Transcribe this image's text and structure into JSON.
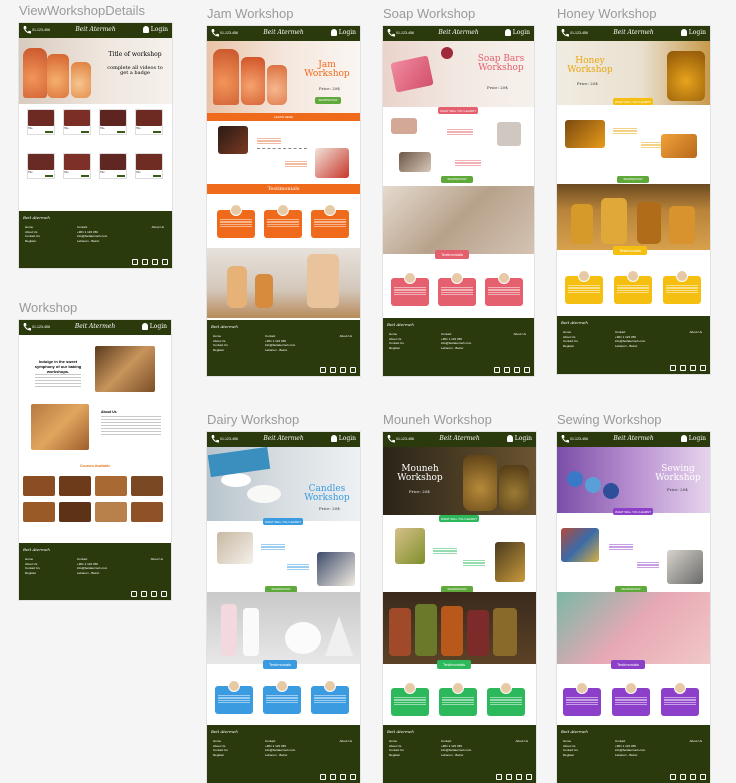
{
  "frames": {
    "view": {
      "label": "ViewWorkshopDetails",
      "hero_title": "Title of workshop",
      "hero_sub": "complete all videos to get a badge",
      "item_label": "Title"
    },
    "workshop": {
      "label": "Workshop",
      "intro_title": "Indulge in the sweet symphony of our baking workshops.",
      "about_title": "About Us",
      "courses_title": "Courses Available"
    },
    "jam": {
      "label": "Jam Workshop",
      "title": "Jam Workshop",
      "price": "Price: 20$",
      "cta": "REGISTER NOW",
      "learn": "LEARN HERE",
      "testimonials": "Testimonials"
    },
    "soap": {
      "label": "Soap Workshop",
      "title": "Soap Bars Workshop",
      "price": "Price: 20$",
      "learn": "WHAT WILL YOU LEARN?",
      "cta": "REGISTER NOW",
      "testimonials": "Testimonials"
    },
    "honey": {
      "label": "Honey Workshop",
      "title": "Honey Workshop",
      "price": "Price: 20$",
      "learn": "WHAT WILL YOU LEARN?",
      "cta": "REGISTER NOW",
      "testimonials": "Testimonials"
    },
    "dairy": {
      "label": "Dairy Workshop",
      "title": "Candles Workshop",
      "price": "Price: 20$",
      "learn": "WHAT WILL YOU LEARN?",
      "cta": "REGISTER NOW",
      "testimonials": "Testimonials"
    },
    "mouneh": {
      "label": "Mouneh Workshop",
      "title": "Mouneh Workshop",
      "price": "Price: 20$",
      "learn": "WHAT WILL YOU LEARN?",
      "cta": "REGISTER NOW",
      "testimonials": "Testimonials"
    },
    "sewing": {
      "label": "Sewing Workshop",
      "title": "Sewing Workshop",
      "price": "Price: 20$",
      "learn": "WHAT WILL YOU LEARN?",
      "cta": "REGISTER NOW",
      "testimonials": "Testimonials"
    }
  },
  "nav": {
    "phone": "01-123-456",
    "logo": "Beit Atermeh",
    "login": "Login"
  },
  "footer": {
    "logo": "Beit Atermeh",
    "links": [
      "Home",
      "About Us",
      "Contact Us",
      "Register"
    ],
    "contact_title": "Contact",
    "contact_lines": [
      "+961 1 123 456",
      "info@beitatermeh.com",
      "Lebanon - Beirut"
    ],
    "about": "About Us"
  },
  "colors": {
    "nav": "#2b3a0c",
    "jam": "#ef6a1b",
    "soap": "#e4606f",
    "honey": "#f4bf11",
    "dairy": "#3a9be0",
    "mouneh": "#2eb85c",
    "sewing": "#8c3fc8",
    "cta": "#5fa83a"
  },
  "icons": [
    "phone-icon",
    "user-icon",
    "facebook-icon",
    "instagram-icon",
    "youtube-icon",
    "twitter-icon"
  ]
}
